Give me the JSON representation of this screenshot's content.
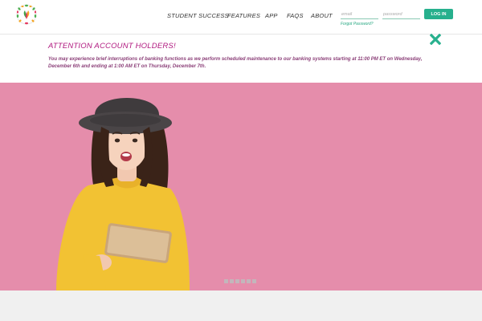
{
  "header": {
    "logo_icon": "leaf-wreath-logo",
    "nav": [
      {
        "label": "STUDENT SUCCESS"
      },
      {
        "label": "FEATURES"
      },
      {
        "label": "APP"
      },
      {
        "label": "FAQS"
      },
      {
        "label": "ABOUT"
      }
    ],
    "login": {
      "email_placeholder": "email",
      "password_placeholder": "password",
      "button_label": "LOG IN",
      "forgot_label": "Forgot Password?"
    },
    "accent_color": "#27b08d"
  },
  "alert": {
    "title": "ATTENTION ACCOUNT HOLDERS!",
    "message": "You may experience brief interruptions of banking functions as we perform scheduled maintenance to our banking systems starting at 11:00 PM ET on Wednesday, December 6th and ending at 1:00 AM ET on Thursday, December 7th.",
    "close_icon": "close-x-icon",
    "title_color": "#b0187f"
  },
  "hero": {
    "background_color": "#e58dab",
    "image": "woman-with-hat-holding-tablet",
    "slide_count": 6
  }
}
